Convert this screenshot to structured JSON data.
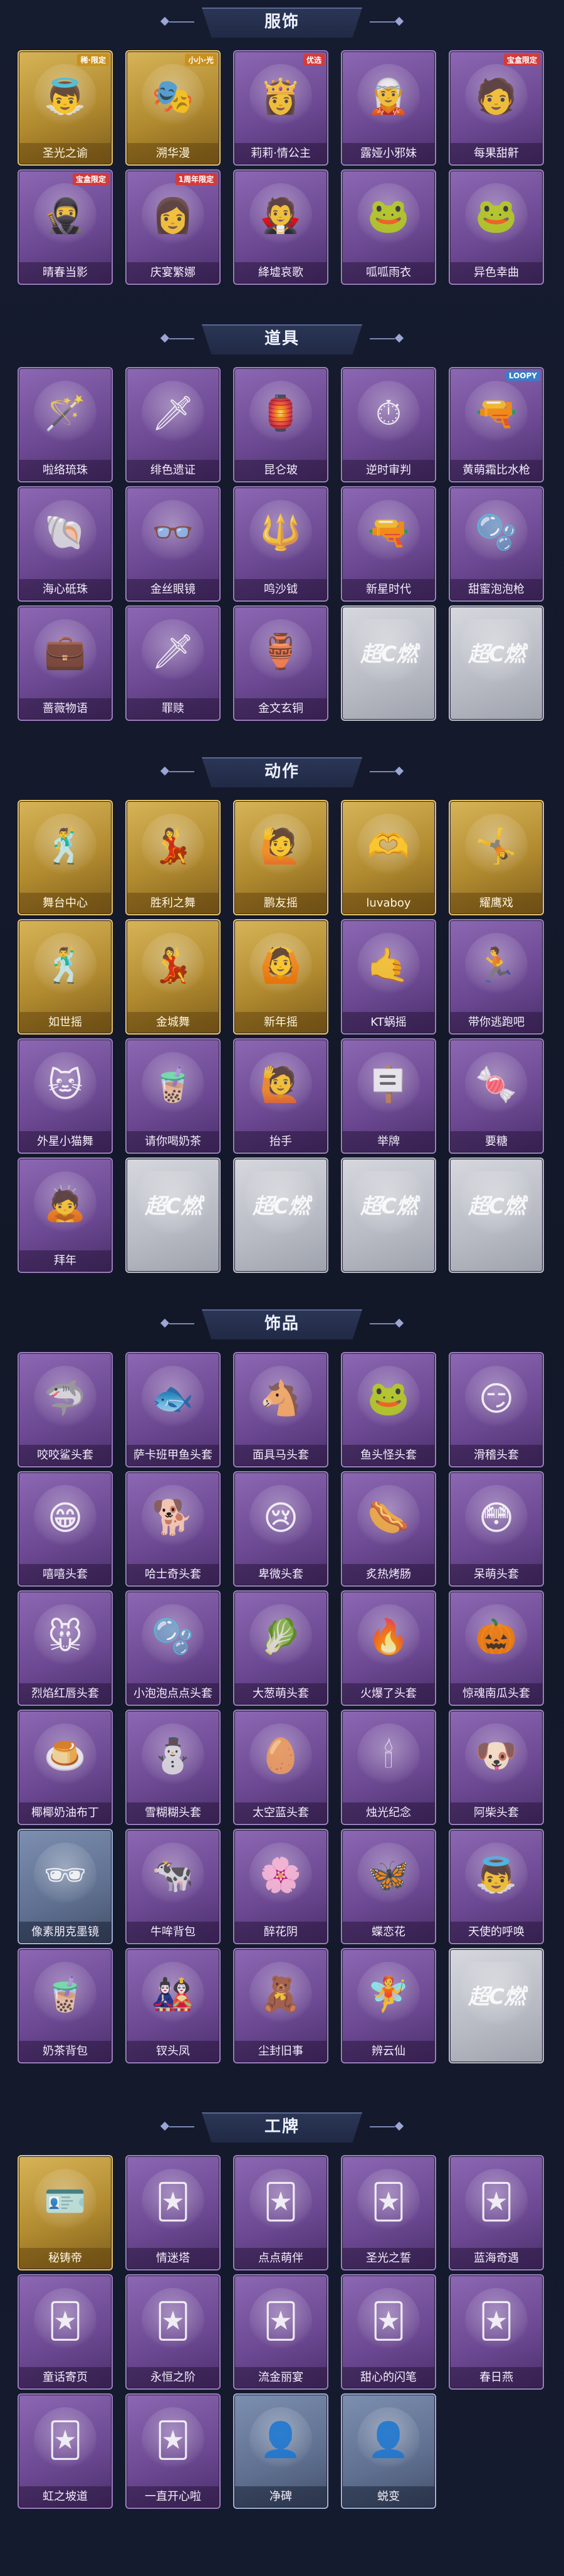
{
  "blank_mark": "超C燃",
  "sections": [
    {
      "title": "服饰",
      "items": [
        {
          "label": "圣光之谕",
          "style": "gold",
          "icon": "angel-costume-icon",
          "glyph": "👼",
          "tag": "稀·限定"
        },
        {
          "label": "溯华漫",
          "style": "gold",
          "icon": "noble-costume-icon",
          "glyph": "🎭",
          "tag": "小小·光"
        },
        {
          "label": "莉莉·情公主",
          "style": "purple",
          "icon": "princess-costume-icon",
          "glyph": "👸",
          "tag": "优选"
        },
        {
          "label": "露娅小邪妹",
          "style": "purple",
          "icon": "witch-costume-icon",
          "glyph": "🧝",
          "tag": ""
        },
        {
          "label": "每果甜鼾",
          "style": "purple",
          "icon": "fruit-costume-icon",
          "glyph": "🧑",
          "tag": "宝盒限定"
        },
        {
          "label": "晴春当影",
          "style": "purple",
          "icon": "swordsman-costume-icon",
          "glyph": "🥷",
          "tag": "宝盒限定"
        },
        {
          "label": "庆宴繁娜",
          "style": "purple",
          "icon": "chef-costume-icon",
          "glyph": "👩",
          "tag": "1周年限定"
        },
        {
          "label": "絳墟哀歌",
          "style": "purple",
          "icon": "gothic-costume-icon",
          "glyph": "🧛",
          "tag": ""
        },
        {
          "label": "呱呱雨衣",
          "style": "purple",
          "icon": "frog-raincoat-icon",
          "glyph": "🐸",
          "tag": ""
        },
        {
          "label": "异色幸曲",
          "style": "purple",
          "icon": "frog-costume-icon",
          "glyph": "🐸",
          "tag": ""
        }
      ]
    },
    {
      "title": "道具",
      "items": [
        {
          "label": "啦络琉珠",
          "style": "purple",
          "icon": "jade-staff-icon",
          "glyph": "🪄",
          "tag": ""
        },
        {
          "label": "绯色遗证",
          "style": "purple",
          "icon": "red-spear-icon",
          "glyph": "🗡",
          "tag": ""
        },
        {
          "label": "昆仑玻",
          "style": "purple",
          "icon": "ornament-icon",
          "glyph": "🏮",
          "tag": ""
        },
        {
          "label": "逆时审判",
          "style": "purple",
          "icon": "clock-wand-icon",
          "glyph": "⏱",
          "tag": ""
        },
        {
          "label": "黄萌霜比水枪",
          "style": "purple",
          "icon": "water-gun-icon",
          "glyph": "🔫",
          "tag": "LOOPY"
        },
        {
          "label": "海心砥珠",
          "style": "purple",
          "icon": "pearl-shell-icon",
          "glyph": "🐚",
          "tag": ""
        },
        {
          "label": "金丝眼镜",
          "style": "purple",
          "icon": "glasses-icon",
          "glyph": "👓",
          "tag": ""
        },
        {
          "label": "鸣沙钺",
          "style": "purple",
          "icon": "staff-icon",
          "glyph": "🔱",
          "tag": ""
        },
        {
          "label": "新星时代",
          "style": "purple",
          "icon": "revolver-icon",
          "glyph": "🔫",
          "tag": ""
        },
        {
          "label": "甜蜜泡泡枪",
          "style": "purple",
          "icon": "bubble-gun-icon",
          "glyph": "🫧",
          "tag": ""
        },
        {
          "label": "蔷薇物语",
          "style": "purple",
          "icon": "medkit-icon",
          "glyph": "💼",
          "tag": ""
        },
        {
          "label": "罪赎",
          "style": "purple",
          "icon": "crimson-spear-icon",
          "glyph": "🗡",
          "tag": ""
        },
        {
          "label": "金文玄铜",
          "style": "purple",
          "icon": "bronze-lantern-icon",
          "glyph": "🏺",
          "tag": ""
        },
        {
          "label": "",
          "style": "blank",
          "icon": "placeholder-icon",
          "glyph": "",
          "tag": ""
        },
        {
          "label": "",
          "style": "blank",
          "icon": "placeholder-icon",
          "glyph": "",
          "tag": ""
        }
      ]
    },
    {
      "title": "动作",
      "items": [
        {
          "label": "舞台中心",
          "style": "gold",
          "icon": "dance-pose-icon",
          "glyph": "🕺",
          "tag": ""
        },
        {
          "label": "胜利之舞",
          "style": "gold",
          "icon": "victory-pose-icon",
          "glyph": "💃",
          "tag": ""
        },
        {
          "label": "鹏友摇",
          "style": "gold",
          "icon": "wave-pose-icon",
          "glyph": "🙋",
          "tag": ""
        },
        {
          "label": "luvaboy",
          "style": "gold",
          "icon": "heart-pose-icon",
          "glyph": "🫶",
          "tag": ""
        },
        {
          "label": "耀鹰戏",
          "style": "gold",
          "icon": "eagle-pose-icon",
          "glyph": "🤸",
          "tag": ""
        },
        {
          "label": "如世摇",
          "style": "gold",
          "icon": "sway-pose-icon",
          "glyph": "🕺",
          "tag": ""
        },
        {
          "label": "金城舞",
          "style": "gold",
          "icon": "golden-dance-icon",
          "glyph": "💃",
          "tag": ""
        },
        {
          "label": "新年摇",
          "style": "gold",
          "icon": "newyear-pose-icon",
          "glyph": "🙆",
          "tag": ""
        },
        {
          "label": "KT蜗摇",
          "style": "purple",
          "icon": "snail-pose-icon",
          "glyph": "🤙",
          "tag": ""
        },
        {
          "label": "带你逃跑吧",
          "style": "purple",
          "icon": "run-pose-icon",
          "glyph": "🏃",
          "tag": ""
        },
        {
          "label": "外星小猫舞",
          "style": "purple",
          "icon": "cat-dance-icon",
          "glyph": "🐱",
          "tag": ""
        },
        {
          "label": "请你喝奶茶",
          "style": "purple",
          "icon": "milktea-pose-icon",
          "glyph": "🧋",
          "tag": ""
        },
        {
          "label": "抬手",
          "style": "purple",
          "icon": "raise-hand-icon",
          "glyph": "🙋",
          "tag": ""
        },
        {
          "label": "举牌",
          "style": "purple",
          "icon": "sign-pose-icon",
          "glyph": "🪧",
          "tag": ""
        },
        {
          "label": "要糖",
          "style": "purple",
          "icon": "candy-pose-icon",
          "glyph": "🍬",
          "tag": ""
        },
        {
          "label": "拜年",
          "style": "purple",
          "icon": "bow-pose-icon",
          "glyph": "🙇",
          "tag": ""
        },
        {
          "label": "",
          "style": "blank",
          "icon": "placeholder-icon",
          "glyph": "",
          "tag": ""
        },
        {
          "label": "",
          "style": "blank",
          "icon": "placeholder-icon",
          "glyph": "",
          "tag": ""
        },
        {
          "label": "",
          "style": "blank",
          "icon": "placeholder-icon",
          "glyph": "",
          "tag": ""
        },
        {
          "label": "",
          "style": "blank",
          "icon": "placeholder-icon",
          "glyph": "",
          "tag": ""
        }
      ]
    },
    {
      "title": "饰品",
      "items": [
        {
          "label": "咬咬鲨头套",
          "style": "purple",
          "icon": "shark-head-icon",
          "glyph": "🦈",
          "tag": ""
        },
        {
          "label": "萨卡班甲鱼头套",
          "style": "purple",
          "icon": "fish-head-icon",
          "glyph": "🐟",
          "tag": ""
        },
        {
          "label": "面具马头套",
          "style": "purple",
          "icon": "horse-head-icon",
          "glyph": "🐴",
          "tag": ""
        },
        {
          "label": "鱼头怪头套",
          "style": "purple",
          "icon": "fish-monster-icon",
          "glyph": "🐸",
          "tag": ""
        },
        {
          "label": "滑稽头套",
          "style": "purple",
          "icon": "smile-head-icon",
          "glyph": "😏",
          "tag": ""
        },
        {
          "label": "嘻嘻头套",
          "style": "purple",
          "icon": "grin-head-icon",
          "glyph": "😁",
          "tag": ""
        },
        {
          "label": "哈士奇头套",
          "style": "purple",
          "icon": "husky-head-icon",
          "glyph": "🐕",
          "tag": ""
        },
        {
          "label": "卑微头套",
          "style": "purple",
          "icon": "sad-head-icon",
          "glyph": "😢",
          "tag": ""
        },
        {
          "label": "炙热烤肠",
          "style": "purple",
          "icon": "sausage-head-icon",
          "glyph": "🌭",
          "tag": ""
        },
        {
          "label": "呆萌头套",
          "style": "purple",
          "icon": "daze-head-icon",
          "glyph": "😳",
          "tag": ""
        },
        {
          "label": "烈焰红唇头套",
          "style": "purple",
          "icon": "pikachu-head-icon",
          "glyph": "🐭",
          "tag": ""
        },
        {
          "label": "小泡泡点点头套",
          "style": "purple",
          "icon": "bubble-head-icon",
          "glyph": "🫧",
          "tag": ""
        },
        {
          "label": "大葱萌头套",
          "style": "purple",
          "icon": "leek-head-icon",
          "glyph": "🥬",
          "tag": ""
        },
        {
          "label": "火爆了头套",
          "style": "purple",
          "icon": "fire-head-icon",
          "glyph": "🔥",
          "tag": ""
        },
        {
          "label": "惊魂南瓜头套",
          "style": "purple",
          "icon": "pumpkin-head-icon",
          "glyph": "🎃",
          "tag": ""
        },
        {
          "label": "椰椰奶油布丁",
          "style": "purple",
          "icon": "pudding-head-icon",
          "glyph": "🍮",
          "tag": ""
        },
        {
          "label": "雪糊糊头套",
          "style": "purple",
          "icon": "snowman-head-icon",
          "glyph": "⛄",
          "tag": ""
        },
        {
          "label": "太空蓝头套",
          "style": "purple",
          "icon": "egg-head-icon",
          "glyph": "🥚",
          "tag": ""
        },
        {
          "label": "烛光纪念",
          "style": "purple",
          "icon": "candle-head-icon",
          "glyph": "🕯",
          "tag": ""
        },
        {
          "label": "阿柴头套",
          "style": "purple",
          "icon": "shiba-head-icon",
          "glyph": "🐶",
          "tag": ""
        },
        {
          "label": "像素朋克墨镜",
          "style": "blue",
          "icon": "pixel-sunglasses-icon",
          "glyph": "🕶",
          "tag": ""
        },
        {
          "label": "牛哞背包",
          "style": "purple",
          "icon": "cow-backpack-icon",
          "glyph": "🐄",
          "tag": ""
        },
        {
          "label": "醉花阴",
          "style": "purple",
          "icon": "flower-hairpin-icon",
          "glyph": "🌸",
          "tag": ""
        },
        {
          "label": "蝶恋花",
          "style": "purple",
          "icon": "butterfly-wings-icon",
          "glyph": "🦋",
          "tag": ""
        },
        {
          "label": "天使的呼唤",
          "style": "purple",
          "icon": "angel-doll-icon",
          "glyph": "👼",
          "tag": ""
        },
        {
          "label": "奶茶背包",
          "style": "purple",
          "icon": "milktea-backpack-icon",
          "glyph": "🧋",
          "tag": ""
        },
        {
          "label": "钗头凤",
          "style": "purple",
          "icon": "phoenix-doll-icon",
          "glyph": "🎎",
          "tag": ""
        },
        {
          "label": "尘封旧事",
          "style": "purple",
          "icon": "chibi-doll-icon",
          "glyph": "🧸",
          "tag": ""
        },
        {
          "label": "辨云仙",
          "style": "purple",
          "icon": "fairy-charm-icon",
          "glyph": "🧚",
          "tag": ""
        },
        {
          "label": "",
          "style": "blank",
          "icon": "placeholder-icon",
          "glyph": "",
          "tag": ""
        }
      ]
    },
    {
      "title": "工牌",
      "items": [
        {
          "label": "秘铸帝",
          "style": "gold",
          "icon": "badge-card-icon",
          "glyph": "🪪",
          "tag": ""
        },
        {
          "label": "情迷塔",
          "style": "purple",
          "icon": "pink-card-icon",
          "glyph": "🃏",
          "tag": ""
        },
        {
          "label": "点点萌伴",
          "style": "purple",
          "icon": "cute-card-icon",
          "glyph": "🃏",
          "tag": ""
        },
        {
          "label": "圣光之誓",
          "style": "purple",
          "icon": "holy-card-icon",
          "glyph": "🃏",
          "tag": ""
        },
        {
          "label": "蓝海奇遇",
          "style": "purple",
          "icon": "ocean-card-icon",
          "glyph": "🃏",
          "tag": ""
        },
        {
          "label": "童话寄页",
          "style": "purple",
          "icon": "fairytale-card-icon",
          "glyph": "🃏",
          "tag": ""
        },
        {
          "label": "永恒之阶",
          "style": "purple",
          "icon": "eternal-card-icon",
          "glyph": "🃏",
          "tag": ""
        },
        {
          "label": "流金丽宴",
          "style": "purple",
          "icon": "gold-feast-card-icon",
          "glyph": "🃏",
          "tag": ""
        },
        {
          "label": "甜心的闪笔",
          "style": "purple",
          "icon": "sweetheart-card-icon",
          "glyph": "🃏",
          "tag": ""
        },
        {
          "label": "春日燕",
          "style": "purple",
          "icon": "spring-card-icon",
          "glyph": "🃏",
          "tag": ""
        },
        {
          "label": "虹之坡道",
          "style": "purple",
          "icon": "rainbow-card-icon",
          "glyph": "🃏",
          "tag": ""
        },
        {
          "label": "一直开心啦",
          "style": "purple",
          "icon": "happy-card-icon",
          "glyph": "🃏",
          "tag": ""
        },
        {
          "label": "净碑",
          "style": "blue",
          "icon": "silhouette-card-icon",
          "glyph": "👤",
          "tag": ""
        },
        {
          "label": "蜕变",
          "style": "blue",
          "icon": "silhouette-card-icon",
          "glyph": "👤",
          "tag": ""
        }
      ]
    }
  ]
}
